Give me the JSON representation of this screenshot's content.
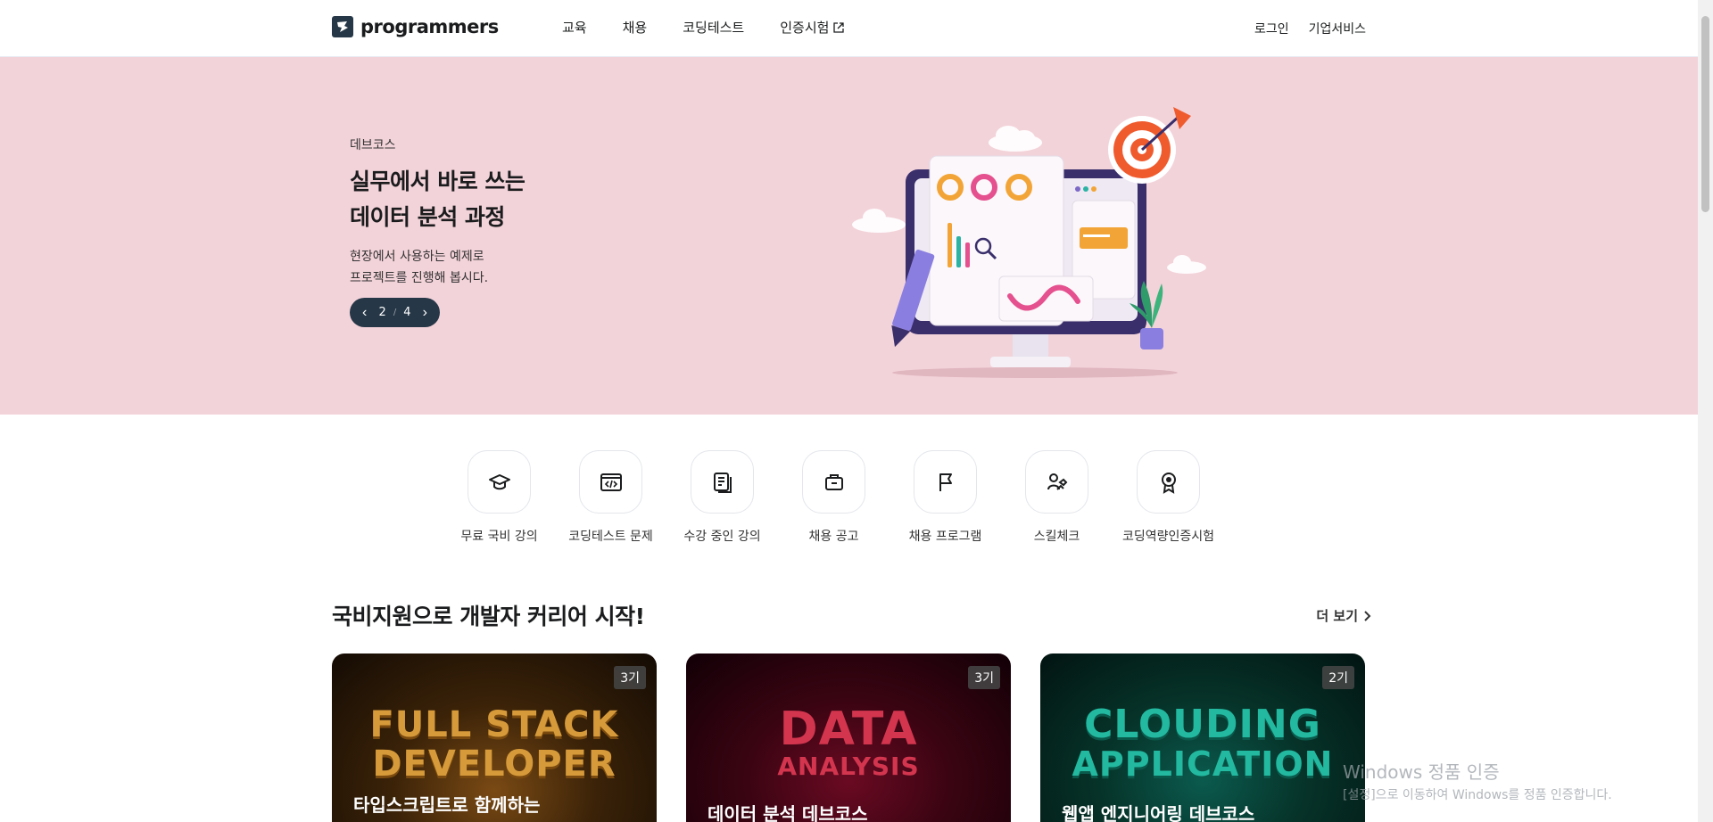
{
  "header": {
    "logo_text": "programmers",
    "nav": [
      "교육",
      "채용",
      "코딩테스트",
      "인증시험"
    ],
    "login": "로그인",
    "business": "기업서비스"
  },
  "hero": {
    "eyebrow": "데브코스",
    "title_line1": "실무에서 바로 쓰는",
    "title_line2": "데이터 분석 과정",
    "desc_line1": "현장에서 사용하는 예제로",
    "desc_line2": "프로젝트를 진행해 봅시다.",
    "pager_current": "2",
    "pager_separator": "/",
    "pager_total": "4",
    "background_color": "#f3d3da"
  },
  "quick_menu": [
    {
      "label": "무료 국비 강의",
      "icon": "graduation-cap-icon"
    },
    {
      "label": "코딩테스트 문제",
      "icon": "code-window-icon"
    },
    {
      "label": "수강 중인 강의",
      "icon": "documents-icon"
    },
    {
      "label": "채용 공고",
      "icon": "briefcase-icon"
    },
    {
      "label": "채용 프로그램",
      "icon": "flag-icon"
    },
    {
      "label": "스킬체크",
      "icon": "skill-check-icon"
    },
    {
      "label": "코딩역량인증시험",
      "icon": "award-badge-icon"
    }
  ],
  "section": {
    "title": "국비지원으로 개발자 커리어 시작!",
    "more": "더 보기"
  },
  "cards": [
    {
      "badge": "3기",
      "logo_line1": "FULL STACK",
      "logo_line2": "DEVELOPER",
      "title": "타입스크립트로 함께하는"
    },
    {
      "badge": "3기",
      "logo_line1": "DATA",
      "logo_line2": "ANALYSIS",
      "title": "데이터 분석 데브코스"
    },
    {
      "badge": "2기",
      "logo_line1": "CLOUDING",
      "logo_line2": "APPLICATION",
      "title": "웹앱 엔지니어링 데브코스"
    }
  ],
  "watermark": {
    "line1": "Windows 정품 인증",
    "line2": "[설정]으로 이동하여 Windows를 정품 인증합니다."
  }
}
